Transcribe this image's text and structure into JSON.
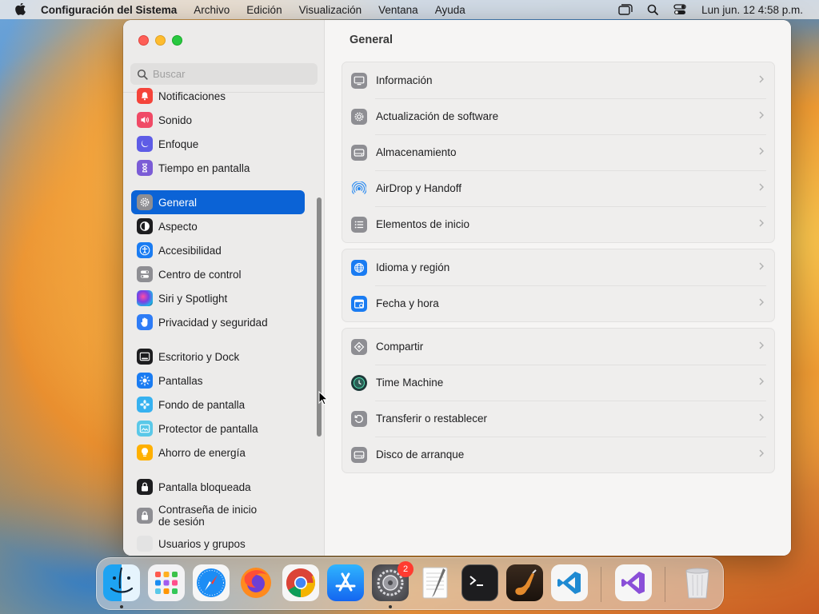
{
  "menubar": {
    "app_name": "Configuración del Sistema",
    "menus": [
      "Archivo",
      "Edición",
      "Visualización",
      "Ventana",
      "Ayuda"
    ],
    "clock": "Lun jun. 12  4:58 p.m."
  },
  "window": {
    "title": "General",
    "search": {
      "placeholder": "Buscar",
      "value": ""
    },
    "sidebar": {
      "items": [
        {
          "label": "Notificaciones",
          "icon": "bell-icon",
          "color": "#f5443a"
        },
        {
          "label": "Sonido",
          "icon": "speaker-icon",
          "color": "#f04a66"
        },
        {
          "label": "Enfoque",
          "icon": "moon-icon",
          "color": "#5e5ce6"
        },
        {
          "label": "Tiempo en pantalla",
          "icon": "hourglass-icon",
          "color": "#7b5cd6"
        },
        {
          "label": "General",
          "icon": "gear-icon",
          "color": "#8e8e93",
          "selected": true
        },
        {
          "label": "Aspecto",
          "icon": "appearance-icon",
          "color": "#1d1d1f"
        },
        {
          "label": "Accesibilidad",
          "icon": "accessibility-icon",
          "color": "#1a7cf2"
        },
        {
          "label": "Centro de control",
          "icon": "toggles-icon",
          "color": "#8e8e93"
        },
        {
          "label": "Siri y Spotlight",
          "icon": "siri-icon",
          "color": "#2f3b8f"
        },
        {
          "label": "Privacidad y seguridad",
          "icon": "hand-icon",
          "color": "#2e7cf6"
        },
        {
          "label": "Escritorio y Dock",
          "icon": "dock-icon",
          "color": "#1d1d1f"
        },
        {
          "label": "Pantallas",
          "icon": "sun-icon",
          "color": "#1a7cf2"
        },
        {
          "label": "Fondo de pantalla",
          "icon": "flower-icon",
          "color": "#36b1f0"
        },
        {
          "label": "Protector de pantalla",
          "icon": "screensaver-icon",
          "color": "#5ac8e8"
        },
        {
          "label": "Ahorro de energía",
          "icon": "bulb-icon",
          "color": "#ffb000"
        },
        {
          "label": "Pantalla bloqueada",
          "icon": "lock-icon",
          "color": "#1d1d1f"
        },
        {
          "label": "Contraseña de inicio de sesión",
          "line1": "Contraseña de inicio",
          "line2": "de sesión",
          "icon": "padlock-icon",
          "color": "#8e8e93"
        },
        {
          "label": "Usuarios y grupos",
          "icon": "users-icon",
          "color": "#e3e3e3"
        }
      ]
    },
    "groups": [
      [
        {
          "label": "Información",
          "icon": "display-icon"
        },
        {
          "label": "Actualización de software",
          "icon": "gear-update-icon"
        },
        {
          "label": "Almacenamiento",
          "icon": "storage-icon"
        },
        {
          "label": "AirDrop y Handoff",
          "icon": "airdrop-icon"
        },
        {
          "label": "Elementos de inicio",
          "icon": "list-icon"
        }
      ],
      [
        {
          "label": "Idioma y región",
          "icon": "globe-icon"
        },
        {
          "label": "Fecha y hora",
          "icon": "calendar-icon"
        }
      ],
      [
        {
          "label": "Compartir",
          "icon": "share-icon"
        },
        {
          "label": "Time Machine",
          "icon": "time-machine-icon"
        },
        {
          "label": "Transferir o restablecer",
          "icon": "reset-icon"
        },
        {
          "label": "Disco de arranque",
          "icon": "disk-icon"
        }
      ]
    ]
  },
  "dock": {
    "apps": [
      {
        "name": "finder-icon",
        "running": true
      },
      {
        "name": "launchpad-icon"
      },
      {
        "name": "safari-icon"
      },
      {
        "name": "firefox-icon"
      },
      {
        "name": "chrome-icon"
      },
      {
        "name": "app-store-icon"
      },
      {
        "name": "system-settings-icon",
        "running": true,
        "badge": "2"
      },
      {
        "name": "textedit-icon"
      },
      {
        "name": "terminal-icon"
      },
      {
        "name": "garageband-icon"
      },
      {
        "name": "vscode-icon"
      },
      {
        "name": "visual-studio-icon"
      },
      {
        "name": "trash-icon"
      }
    ]
  }
}
